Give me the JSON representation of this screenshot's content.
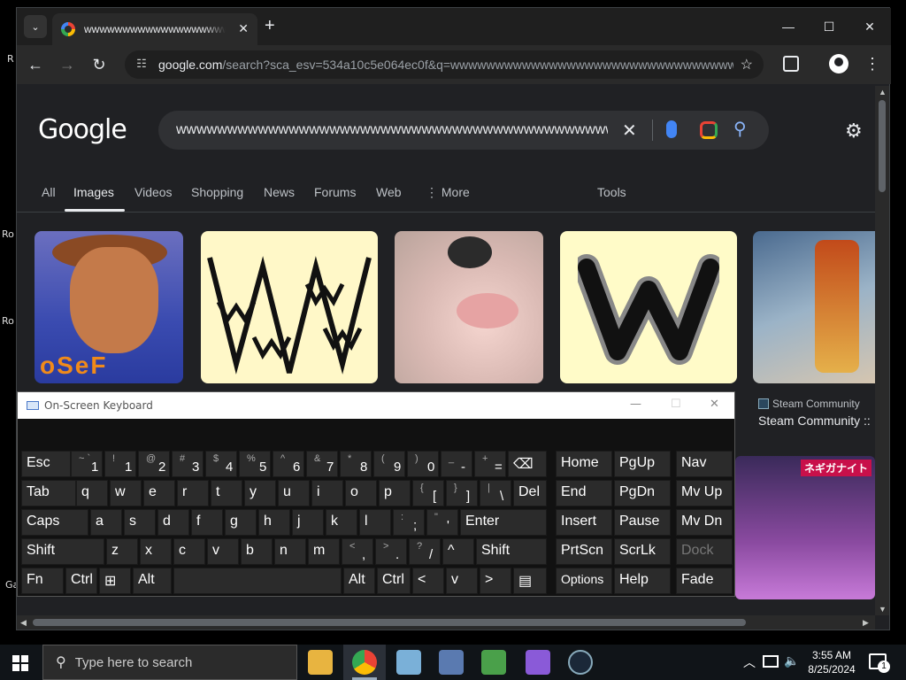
{
  "desktop": {
    "side_labels": [
      "R",
      "Ro",
      "Ro",
      "Ga"
    ]
  },
  "browser": {
    "tab": {
      "title": "wwwwwwwwwwwwwwwwwwwwwwwwwwwwwwwwwwwwww",
      "close_glyph": "✕"
    },
    "new_tab_glyph": "+",
    "window_controls": {
      "minimize": "—",
      "maximize": "☐",
      "close": "✕"
    },
    "nav": {
      "back": "←",
      "forward": "→",
      "reload": "↻"
    },
    "url": {
      "host": "google.com",
      "path": "/search?sca_esv=534a10c5e064ec0f&q=wwwwwwwwwwwwwwwwwwwwwwwwwwwwwwwwwwwwwww..."
    },
    "icons": [
      "site-info-icon",
      "bookmark-star-icon",
      "extensions-icon",
      "profile-icon",
      "menu-icon"
    ]
  },
  "google": {
    "logo": "Google",
    "query": "wwwwwwwwwwwwwwwwwwwwwwwwwwwwwwwwwwwwwwwwwwwwwwwwwwwwwwwwwwww",
    "clear_glyph": "✕",
    "search_glyph": "⚲",
    "settings_glyph": "⚙",
    "filters": [
      "All",
      "Images",
      "Videos",
      "Shopping",
      "News",
      "Forums",
      "Web",
      "⋮ More",
      "Tools"
    ],
    "active_filter": "Images",
    "results": {
      "images": [
        "woody-thumbnail",
        "scribble-w-thumbnail",
        "cat-thumbnail",
        "w-letter-thumbnail",
        "game-character-thumbnail",
        "anime-thumbnail"
      ],
      "woody_caption": "oSeF",
      "w_letter": "W",
      "source": "Steam Community",
      "title": "Steam Community ::",
      "anime_label": "ネギガナイト"
    }
  },
  "osk": {
    "title": "On-Screen Keyboard",
    "rows": [
      [
        {
          "main": "Esc"
        },
        {
          "sub": "~ `",
          "bot": "1"
        },
        {
          "sub": "!",
          "bot": "1"
        },
        {
          "sub": "@",
          "bot": "2"
        },
        {
          "sub": "#",
          "bot": "3"
        },
        {
          "sub": "$",
          "bot": "4"
        },
        {
          "sub": "%",
          "bot": "5"
        },
        {
          "sub": "^",
          "bot": "6"
        },
        {
          "sub": "&",
          "bot": "7"
        },
        {
          "sub": "*",
          "bot": "8"
        },
        {
          "sub": "(",
          "bot": "9"
        },
        {
          "sub": ")",
          "bot": "0"
        },
        {
          "sub": "_",
          "bot": "-"
        },
        {
          "sub": "+",
          "bot": "="
        },
        {
          "main": "⌫"
        }
      ],
      [
        {
          "main": "Tab"
        },
        {
          "main": "q"
        },
        {
          "main": "w"
        },
        {
          "main": "e"
        },
        {
          "main": "r"
        },
        {
          "main": "t"
        },
        {
          "main": "y"
        },
        {
          "main": "u"
        },
        {
          "main": "i"
        },
        {
          "main": "o"
        },
        {
          "main": "p"
        },
        {
          "sub": "{",
          "bot": "["
        },
        {
          "sub": "}",
          "bot": "]"
        },
        {
          "sub": "|",
          "bot": "\\"
        },
        {
          "main": "Del"
        }
      ],
      [
        {
          "main": "Caps"
        },
        {
          "main": "a"
        },
        {
          "main": "s"
        },
        {
          "main": "d"
        },
        {
          "main": "f"
        },
        {
          "main": "g"
        },
        {
          "main": "h"
        },
        {
          "main": "j"
        },
        {
          "main": "k"
        },
        {
          "main": "l"
        },
        {
          "sub": ":",
          "bot": ";"
        },
        {
          "sub": "\"",
          "bot": "'"
        },
        {
          "main": "Enter"
        }
      ],
      [
        {
          "main": "Shift"
        },
        {
          "main": "z"
        },
        {
          "main": "x"
        },
        {
          "main": "c"
        },
        {
          "main": "v"
        },
        {
          "main": "b"
        },
        {
          "main": "n"
        },
        {
          "main": "m"
        },
        {
          "sub": "<",
          "bot": ","
        },
        {
          "sub": ">",
          "bot": "."
        },
        {
          "sub": "?",
          "bot": "/"
        },
        {
          "main": "^"
        },
        {
          "main": "Shift"
        }
      ],
      [
        {
          "main": "Fn"
        },
        {
          "main": "Ctrl"
        },
        {
          "main": "⊞"
        },
        {
          "main": "Alt"
        },
        {
          "main": ""
        },
        {
          "main": "Alt"
        },
        {
          "main": "Ctrl"
        },
        {
          "main": "<"
        },
        {
          "main": "v"
        },
        {
          "main": ">"
        },
        {
          "main": "▤"
        }
      ]
    ],
    "side_keys": [
      [
        "Home",
        "PgUp",
        "Nav"
      ],
      [
        "End",
        "PgDn",
        "Mv Up"
      ],
      [
        "Insert",
        "Pause",
        "Mv Dn"
      ],
      [
        "PrtScn",
        "ScrLk",
        "Dock"
      ],
      [
        "Options",
        "Help",
        "Fade"
      ]
    ]
  },
  "taskbar": {
    "search_placeholder": "Type here to search",
    "apps": [
      "file-explorer-icon",
      "chrome-icon",
      "notepad-icon",
      "app-icon",
      "minecraft-icon",
      "visual-studio-icon",
      "steam-icon"
    ],
    "time": "3:55 AM",
    "date": "8/25/2024",
    "notifications": "1"
  }
}
